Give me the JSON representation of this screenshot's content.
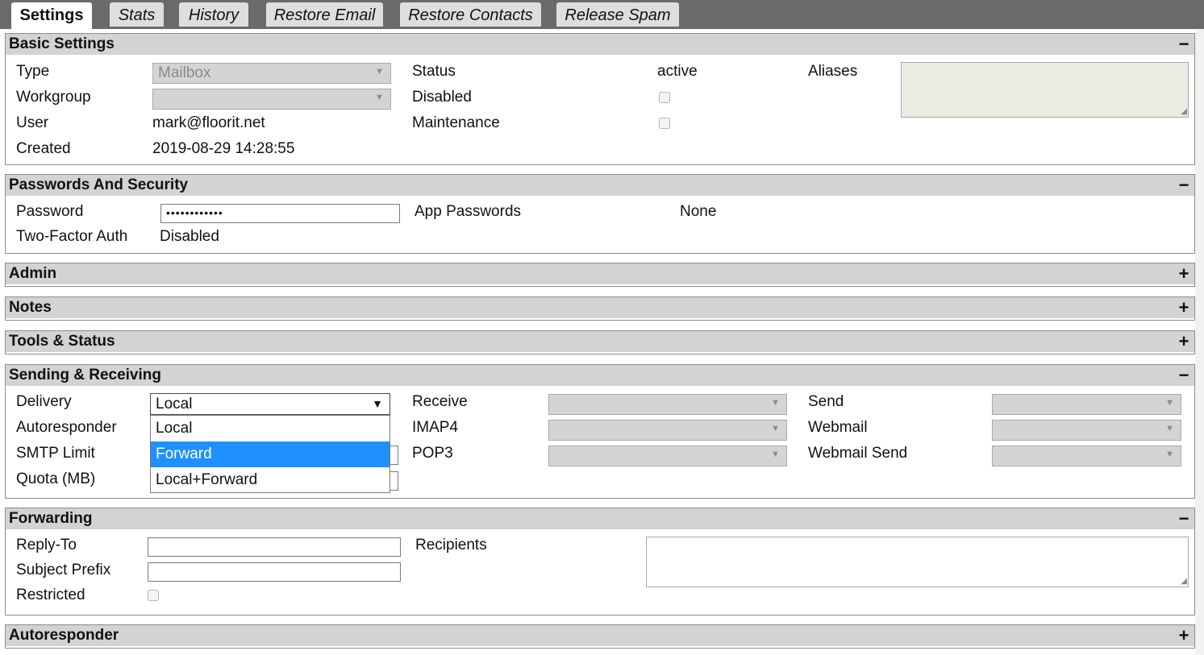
{
  "tabs": [
    "Settings",
    "Stats",
    "History",
    "Restore Email",
    "Restore Contacts",
    "Release Spam"
  ],
  "basic": {
    "title": "Basic Settings",
    "toggle": "−",
    "type_label": "Type",
    "type_value": "Mailbox",
    "workgroup_label": "Workgroup",
    "workgroup_value": "",
    "user_label": "User",
    "user_value": "mark@floorit.net",
    "created_label": "Created",
    "created_value": "2019-08-29 14:28:55",
    "status_label": "Status",
    "status_value": "active",
    "disabled_label": "Disabled",
    "maintenance_label": "Maintenance",
    "aliases_label": "Aliases"
  },
  "security": {
    "title": "Passwords And Security",
    "toggle": "−",
    "password_label": "Password",
    "password_value": "••••••••••••",
    "twofa_label": "Two-Factor Auth",
    "twofa_value": "Disabled",
    "apppw_label": "App Passwords",
    "apppw_value": "None"
  },
  "admin": {
    "title": "Admin",
    "toggle": "+"
  },
  "notes": {
    "title": "Notes",
    "toggle": "+"
  },
  "tools": {
    "title": "Tools & Status",
    "toggle": "+"
  },
  "sending": {
    "title": "Sending & Receiving",
    "toggle": "−",
    "delivery_label": "Delivery",
    "delivery_value": "Local",
    "delivery_options": [
      "Local",
      "Forward",
      "Local+Forward"
    ],
    "autoresponder_label": "Autoresponder",
    "smtp_label": "SMTP Limit",
    "quota_label": "Quota (MB)",
    "receive_label": "Receive",
    "imap_label": "IMAP4",
    "pop_label": "POP3",
    "send_label": "Send",
    "webmail_label": "Webmail",
    "webmail_send_label": "Webmail Send"
  },
  "forwarding": {
    "title": "Forwarding",
    "toggle": "−",
    "replyto_label": "Reply-To",
    "subject_label": "Subject Prefix",
    "restricted_label": "Restricted",
    "recipients_label": "Recipients"
  },
  "autoresponder": {
    "title": "Autoresponder",
    "toggle": "+"
  },
  "icons": {
    "dropdown_arrow": "▼",
    "resize_grip": "◢"
  },
  "colors": {
    "tab_bar": "#6a6a6a",
    "section_header": "#d3d3d3",
    "highlight": "#1e90ff"
  }
}
